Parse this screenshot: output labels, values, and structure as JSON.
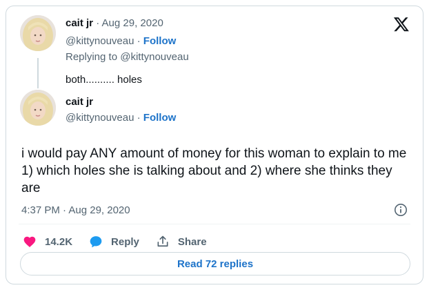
{
  "parent_tweet": {
    "display_name": "cait jr",
    "date": "Aug 29, 2020",
    "handle": "@kittynouveau",
    "follow_label": "Follow",
    "replying_to": "Replying to @kittynouveau",
    "text": "both.......... holes"
  },
  "main_tweet": {
    "display_name": "cait jr",
    "handle": "@kittynouveau",
    "follow_label": "Follow",
    "text": "i would pay ANY amount of money for this woman to explain to me 1) which holes she is talking about and 2) where she thinks they are",
    "timestamp": "4:37 PM · Aug 29, 2020"
  },
  "actions": {
    "likes": "14.2K",
    "reply_label": "Reply",
    "share_label": "Share"
  },
  "read_replies_label": "Read 72 replies",
  "colors": {
    "link": "#1d73c9",
    "muted": "#536471",
    "like": "#f91880",
    "reply": "#1d9bf0",
    "border": "#cfd9de"
  },
  "icons": [
    "x-logo-icon",
    "heart-icon",
    "reply-bubble-icon",
    "share-icon",
    "info-icon"
  ]
}
